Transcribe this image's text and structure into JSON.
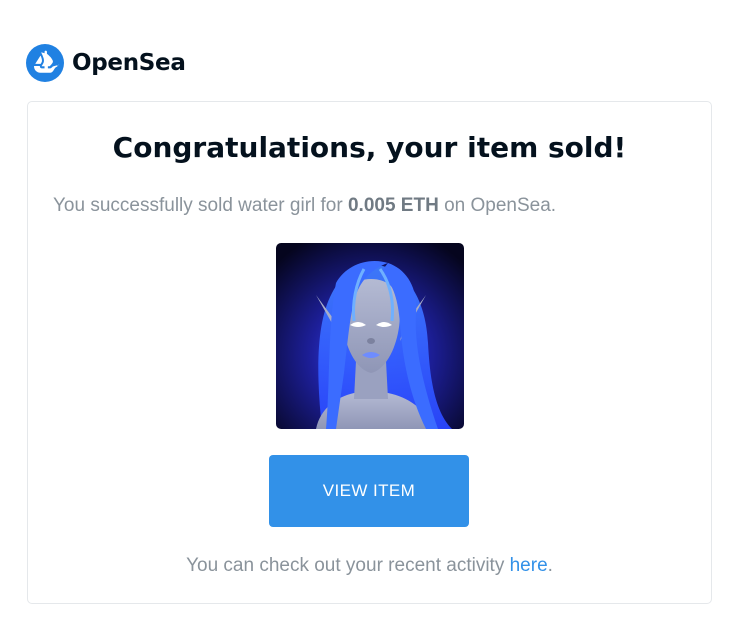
{
  "brand": {
    "name": "OpenSea",
    "logo_icon": "opensea-boat-logo",
    "color": "#2081e2"
  },
  "email": {
    "title": "Congratulations, your item sold!",
    "message_prefix": "You successfully sold water girl for ",
    "amount": "0.005 ETH",
    "message_suffix": " on OpenSea.",
    "nft_image": "water-girl-nft-illustration",
    "button_label": "VIEW ITEM",
    "button_color": "#3291e8",
    "footer_prefix": "You can check out your recent activity ",
    "footer_link": "here",
    "footer_suffix": "."
  }
}
